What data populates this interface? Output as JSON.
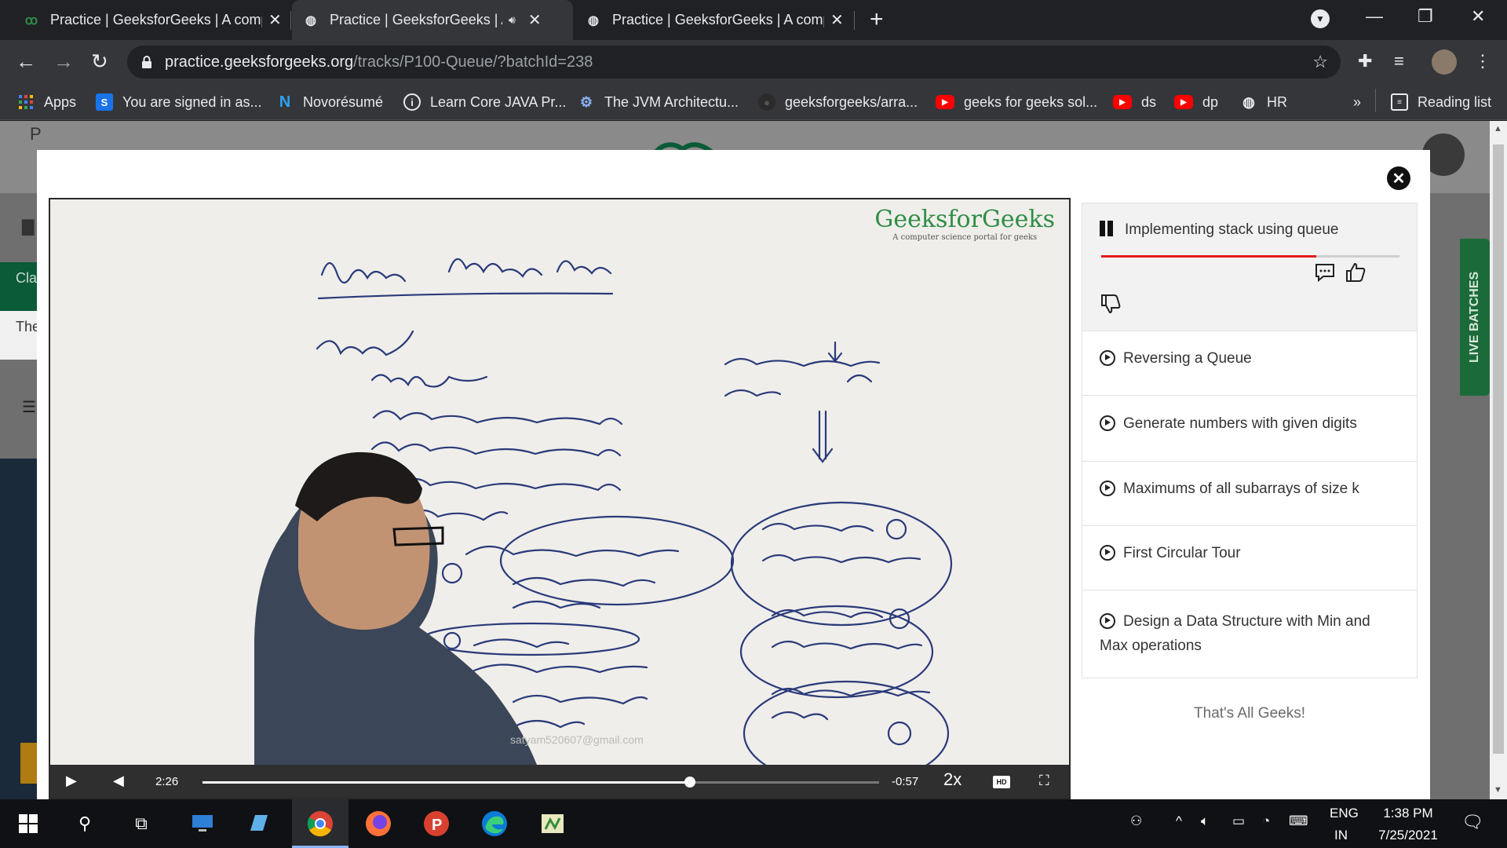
{
  "browser": {
    "tabs": [
      {
        "title": "Practice | GeeksforGeeks | A comp",
        "favicon": "gfg-icon",
        "active": false
      },
      {
        "title": "Practice | GeeksforGeeks | A",
        "favicon": "globe-icon",
        "active": true,
        "audio": true
      },
      {
        "title": "Practice | GeeksforGeeks | A comp",
        "favicon": "globe-icon",
        "active": false
      }
    ],
    "url_host": "practice.geeksforgeeks.org",
    "url_path": "/tracks/P100-Queue/?batchId=238",
    "bookmarks": [
      {
        "label": "Apps",
        "icon": "apps-grid-icon"
      },
      {
        "label": "You are signed in as...",
        "icon": "s-icon"
      },
      {
        "label": "Novorésumé",
        "icon": "n-icon"
      },
      {
        "label": "Learn Core JAVA Pr...",
        "icon": "info-icon"
      },
      {
        "label": "The JVM Architectu...",
        "icon": "gear-icon"
      },
      {
        "label": "geeksforgeeks/arra...",
        "icon": "github-icon"
      },
      {
        "label": "geeks for geeks sol...",
        "icon": "youtube-icon"
      },
      {
        "label": "ds",
        "icon": "youtube-icon"
      },
      {
        "label": "dp",
        "icon": "youtube-icon"
      },
      {
        "label": "HR",
        "icon": "globe-icon"
      }
    ],
    "more_bookmarks": "»",
    "reading_list": "Reading list"
  },
  "page": {
    "live_batches": "LIVE BATCHES",
    "bg_snippets": [
      "P",
      "Cla",
      "The"
    ]
  },
  "video": {
    "logo_name": "GeeksforGeeks",
    "logo_tagline": "A computer science portal for geeks",
    "watermark": "satyam520607@gmail.com",
    "elapsed": "2:26",
    "remaining": "-0:57",
    "speed": "2x",
    "hd": "HD",
    "progress_fraction": 0.72
  },
  "playlist": {
    "current": {
      "title": "Implementing stack using queue",
      "progress_fraction": 0.72
    },
    "items": [
      {
        "title": "Reversing a Queue"
      },
      {
        "title": "Generate numbers with given digits"
      },
      {
        "title": "Maximums of all subarrays of size k"
      },
      {
        "title": "First Circular Tour"
      },
      {
        "title": "Design a Data Structure with Min and Max operations"
      }
    ],
    "footer": "That's All Geeks!"
  },
  "taskbar": {
    "lang_top": "ENG",
    "lang_bottom": "IN",
    "time": "1:38 PM",
    "date": "7/25/2021"
  }
}
